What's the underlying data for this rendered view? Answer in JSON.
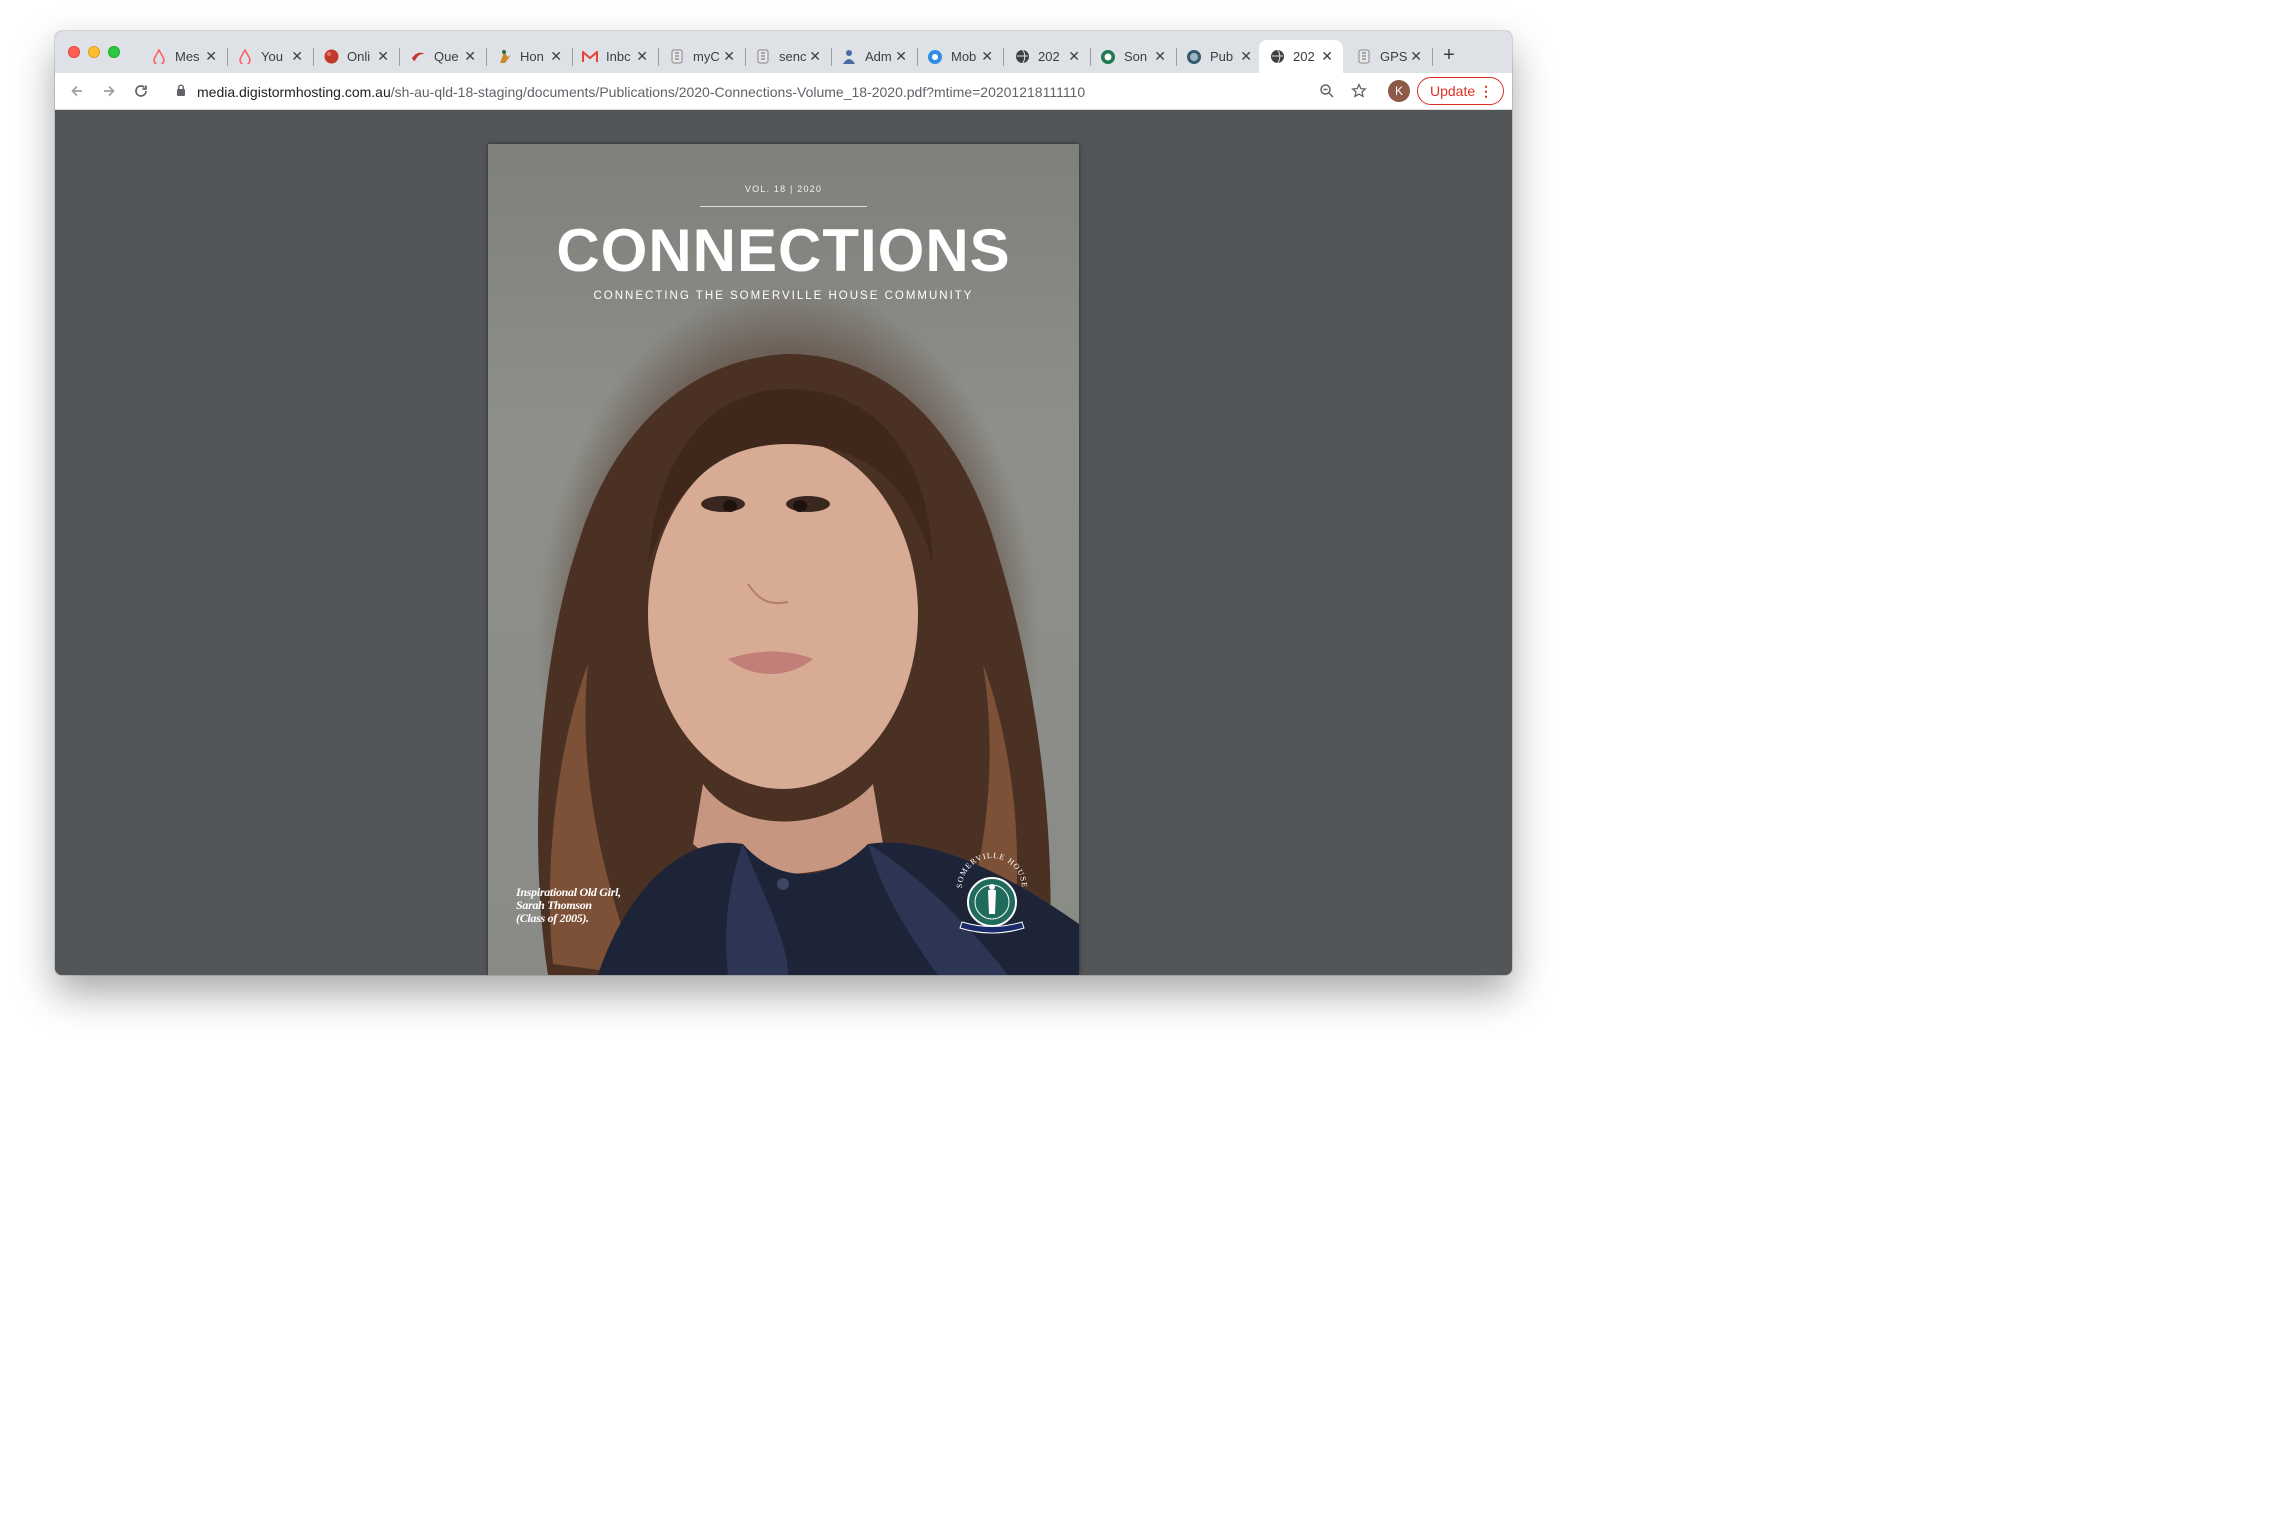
{
  "browser": {
    "tabs": [
      {
        "title": "Mes",
        "icon": "airbnb-icon",
        "active": false
      },
      {
        "title": "You",
        "icon": "airbnb-icon",
        "active": false
      },
      {
        "title": "Onli",
        "icon": "red-ball-icon",
        "active": false
      },
      {
        "title": "Que",
        "icon": "crescent-logo-icon",
        "active": false
      },
      {
        "title": "Hon",
        "icon": "bird-logo-icon",
        "active": false
      },
      {
        "title": "Inbc",
        "icon": "gmail-icon",
        "active": false
      },
      {
        "title": "myC",
        "icon": "crest-icon",
        "active": false
      },
      {
        "title": "senc",
        "icon": "crest-icon",
        "active": false
      },
      {
        "title": "Adm",
        "icon": "person-logo-icon",
        "active": false
      },
      {
        "title": "Mob",
        "icon": "blue-circle-icon",
        "active": false
      },
      {
        "title": "202",
        "icon": "globe-icon",
        "active": false
      },
      {
        "title": "Son",
        "icon": "green-circle-icon",
        "active": false
      },
      {
        "title": "Pub",
        "icon": "seal-icon",
        "active": false
      },
      {
        "title": "202",
        "icon": "globe-icon",
        "active": true
      },
      {
        "title": "GPS",
        "icon": "crest-icon",
        "active": false
      }
    ],
    "new_tab": "+",
    "url_host": "media.digistormhosting.com.au",
    "url_path": "/sh-au-qld-18-staging/documents/Publications/2020-Connections-Volume_18-2020.pdf?mtime=20201218111110",
    "avatar_letter": "K",
    "update_label": "Update"
  },
  "document": {
    "vol": "VOL. 18 | 2020",
    "title": "CONNECTIONS",
    "subtitle": "CONNECTING THE SOMERVILLE HOUSE COMMUNITY",
    "caption_line1": "Inspirational Old Girl,",
    "caption_line2": "Sarah Thomson",
    "caption_line3": "(Class of 2005).",
    "crest_text": "SOMERVILLE HOUSE",
    "crest_motto": "FRANGAR NON FLECTAR"
  },
  "colors": {
    "update_red": "#d93025",
    "viewer_bg": "#525659",
    "tabstrip_bg": "#dee1e6"
  }
}
